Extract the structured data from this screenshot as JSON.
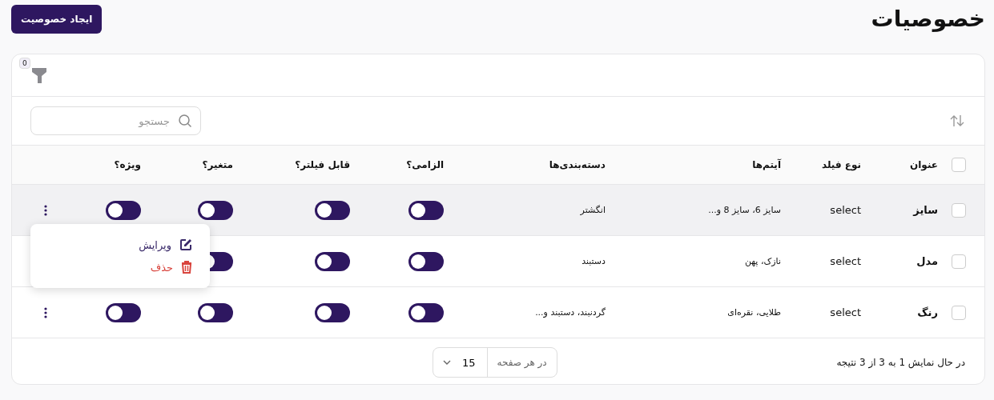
{
  "page_title": "خصوصیات",
  "create_button": "ایجاد خصوصیت",
  "filter": {
    "count": "0"
  },
  "search": {
    "placeholder": "جستجو"
  },
  "table": {
    "columns": [
      "عنوان",
      "نوع فیلد",
      "آیتم‌ها",
      "دسته‌بندی‌ها",
      "الزامی؟",
      "قابل فیلتر؟",
      "متغیر؟",
      "ویژه؟"
    ],
    "header_checked": false,
    "rows": [
      {
        "title": "سایز",
        "field_type": "select",
        "items": "سایز 6، سایز 8 و...",
        "categories": "انگشتر",
        "checked": false,
        "hovered": true,
        "toggles": [
          {
            "on": false
          },
          {
            "on": false
          },
          {
            "on": false
          },
          {
            "on": false
          }
        ]
      },
      {
        "title": "مدل",
        "field_type": "select",
        "items": "نازک، پهن",
        "categories": "دستبند",
        "checked": false,
        "hovered": false,
        "toggles": [
          {
            "on": false
          },
          {
            "on": false
          },
          {
            "on": false
          }
        ]
      },
      {
        "title": "رنگ",
        "field_type": "select",
        "items": "طلایی، نقره‌ای",
        "categories": "گردنبند، دستبند و...",
        "checked": false,
        "hovered": false,
        "toggles": [
          {
            "on": false
          },
          {
            "on": false
          },
          {
            "on": false
          },
          {
            "on": false
          }
        ]
      }
    ]
  },
  "row_menu": {
    "items": [
      {
        "label": "ویرایش",
        "kind": "edit"
      },
      {
        "label": "حذف",
        "kind": "delete"
      }
    ]
  },
  "footer": {
    "summary": "در حال نمایش 1 به 3 از 3 نتیجه",
    "per_page_label": "در هر صفحه",
    "per_page": "15"
  }
}
